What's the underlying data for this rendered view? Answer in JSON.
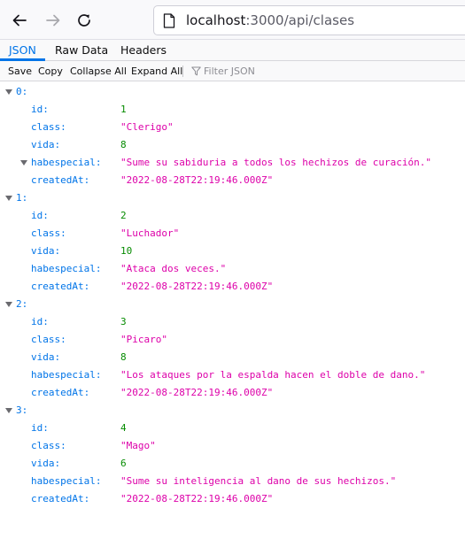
{
  "browser": {
    "url_host": "localhost",
    "url_rest": ":3000/api/clases"
  },
  "tabs": [
    {
      "label": "JSON",
      "active": true
    },
    {
      "label": "Raw Data",
      "active": false
    },
    {
      "label": "Headers",
      "active": false
    }
  ],
  "toolbar": {
    "save": "Save",
    "copy": "Copy",
    "collapse_all": "Collapse All",
    "expand_all": "Expand All",
    "filter_placeholder": "Filter JSON"
  },
  "items": [
    {
      "index": "0:",
      "id": "1",
      "class": "\"Clerigo\"",
      "vida": "8",
      "habespecial": "\"Sume su sabiduria a todos los hechizos de curación.\"",
      "createdAt": "\"2022-08-28T22:19:46.000Z\""
    },
    {
      "index": "1:",
      "id": "2",
      "class": "\"Luchador\"",
      "vida": "10",
      "habespecial": "\"Ataca dos veces.\"",
      "createdAt": "\"2022-08-28T22:19:46.000Z\""
    },
    {
      "index": "2:",
      "id": "3",
      "class": "\"Picaro\"",
      "vida": "8",
      "habespecial": "\"Los ataques por la espalda hacen el doble de dano.\"",
      "createdAt": "\"2022-08-28T22:19:46.000Z\""
    },
    {
      "index": "3:",
      "id": "4",
      "class": "\"Mago\"",
      "vida": "6",
      "habespecial": "\"Sume su inteligencia al dano de sus hechizos.\"",
      "createdAt": "\"2022-08-28T22:19:46.000Z\""
    }
  ],
  "keys": {
    "id": "id:",
    "class": "class:",
    "vida": "vida:",
    "habespecial": "habespecial:",
    "createdAt": "createdAt:"
  },
  "colors": {
    "key": "#0074e8",
    "number": "#058b00",
    "string": "#dd00a9",
    "accent": "#0074e8"
  }
}
